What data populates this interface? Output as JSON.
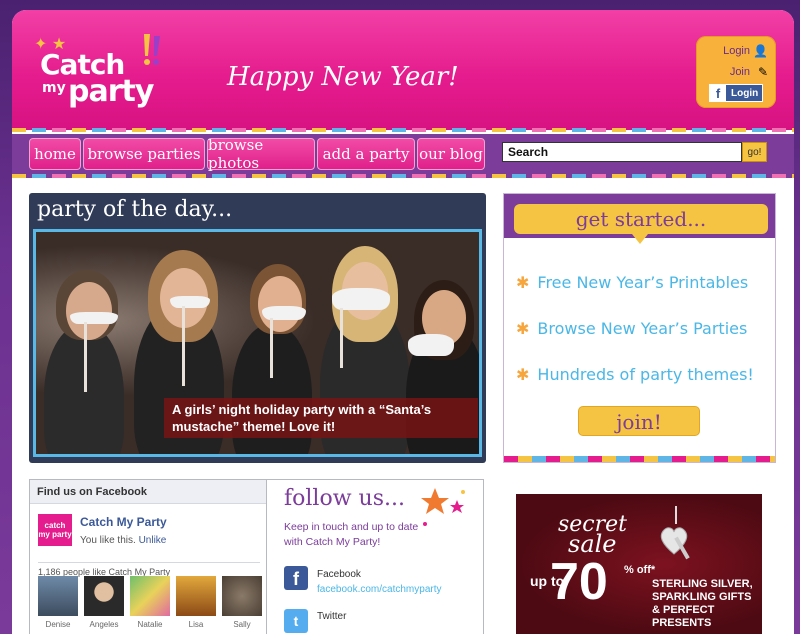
{
  "header": {
    "logo_line1": "Catch",
    "logo_line2": "my",
    "logo_line3": "party",
    "tagline": "Happy New Year!",
    "login_label": "Login",
    "join_label": "Join",
    "fb_login_label": "Login"
  },
  "nav": {
    "items": [
      "home",
      "browse parties",
      "browse photos",
      "add a party",
      "our blog"
    ],
    "search_value": "Search",
    "go_label": "go!"
  },
  "potd": {
    "title": "party of the day...",
    "caption": "A girls’ night holiday party with a “Santa’s mustache” theme! Love it!"
  },
  "get_started": {
    "title": "get started...",
    "items": [
      "Free New Year’s Printables",
      "Browse New Year’s Parties",
      "Hundreds of party themes!"
    ],
    "join_label": "join!"
  },
  "facebook": {
    "heading": "Find us on Facebook",
    "page_thumb": "catch my party",
    "page_name": "Catch My Party",
    "you_like": "You like this.",
    "unlike": "Unlike",
    "count_text": "1,186 people like Catch My Party",
    "fans": [
      "Denise",
      "Angeles",
      "Natalie",
      "Lisa",
      "Sally"
    ]
  },
  "follow": {
    "title": "follow us...",
    "desc": "Keep in touch and up to date with Catch My Party!",
    "facebook_label": "Facebook",
    "facebook_url": "facebook.com/catchmyparty",
    "twitter_label": "Twitter"
  },
  "ad": {
    "line1": "secret",
    "line2": "sale",
    "up_to": "up to",
    "percent": "70",
    "off": "% off*",
    "text": "STERLING SILVER, SPARKLING GIFTS & PERFECT PRESENTS"
  },
  "colors": {
    "brand_pink": "#e51c8d",
    "brand_purple": "#7b3c9a",
    "accent_yellow": "#f6c443",
    "accent_blue": "#4ab7e6"
  }
}
